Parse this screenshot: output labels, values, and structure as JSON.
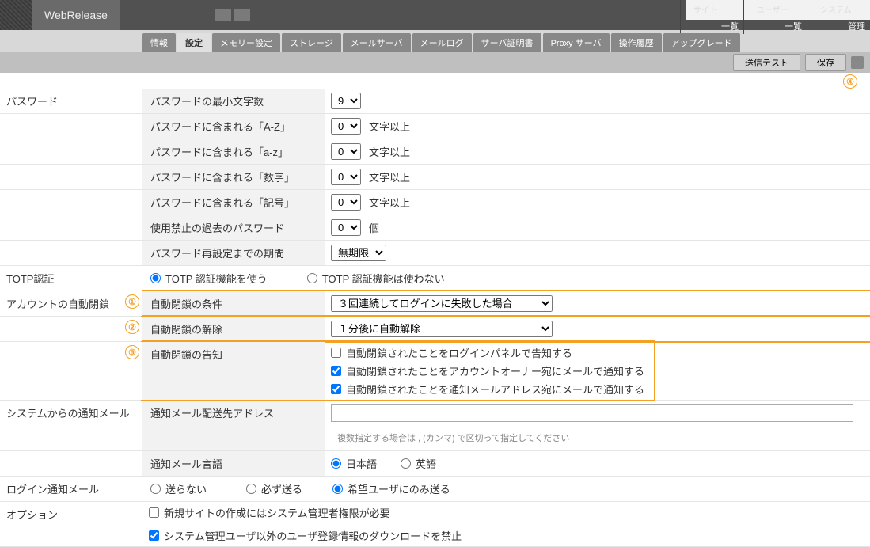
{
  "brand": "WebRelease",
  "topmenu": {
    "site": {
      "label": "サイト",
      "link": "一覧"
    },
    "user": {
      "label": "ユーザー",
      "link": "一覧"
    },
    "system": {
      "label": "システム",
      "link": "管理"
    }
  },
  "tabs": [
    "情報",
    "設定",
    "メモリー設定",
    "ストレージ",
    "メールサーバ",
    "メールログ",
    "サーバ証明書",
    "Proxy サーバ",
    "操作履歴",
    "アップグレード"
  ],
  "active_tab_index": 1,
  "toolbar": {
    "test_btn": "送信テスト",
    "save_btn": "保存"
  },
  "sections": {
    "password": {
      "label": "パスワード",
      "min_len_label": "パスワードの最小文字数",
      "min_len_value": "9",
      "upper_label": "パスワードに含まれる「A-Z」",
      "upper_value": "0",
      "lower_label": "パスワードに含まれる「a-z」",
      "lower_value": "0",
      "digit_label": "パスワードに含まれる「数字」",
      "digit_value": "0",
      "symbol_label": "パスワードに含まれる「記号」",
      "symbol_value": "0",
      "suffix_chars": "文字以上",
      "history_label": "使用禁止の過去のパスワード",
      "history_value": "0",
      "history_suffix": "個",
      "reset_label": "パスワード再設定までの期間",
      "reset_value": "無期限"
    },
    "totp": {
      "label": "TOTP認証",
      "use": "TOTP 認証機能を使う",
      "nouse": "TOTP 認証機能は使わない"
    },
    "lockout": {
      "label": "アカウントの自動閉鎖",
      "cond_label": "自動閉鎖の条件",
      "cond_value": "３回連続してログインに失敗した場合",
      "unlock_label": "自動閉鎖の解除",
      "unlock_value": "１分後に自動解除",
      "notify_label": "自動閉鎖の告知",
      "notify_panel": "自動閉鎖されたことをログインパネルで告知する",
      "notify_owner": "自動閉鎖されたことをアカウントオーナー宛にメールで通知する",
      "notify_addr": "自動閉鎖されたことを通知メールアドレス宛にメールで通知する",
      "markers": {
        "m1": "①",
        "m2": "②",
        "m3": "③",
        "m4": "④"
      }
    },
    "sysmail": {
      "label": "システムからの通知メール",
      "addr_label": "通知メール配送先アドレス",
      "addr_hint": "複数指定する場合は , (カンマ) で区切って指定してください",
      "lang_label": "通知メール言語",
      "lang_ja": "日本語",
      "lang_en": "英語"
    },
    "loginmail": {
      "label": "ログイン通知メール",
      "none": "送らない",
      "always": "必ず送る",
      "pref": "希望ユーザにのみ送る"
    },
    "options": {
      "label": "オプション",
      "opt1": "新規サイトの作成にはシステム管理者権限が必要",
      "opt2": "システム管理ユーザ以外のユーザ登録情報のダウンロードを禁止"
    }
  }
}
